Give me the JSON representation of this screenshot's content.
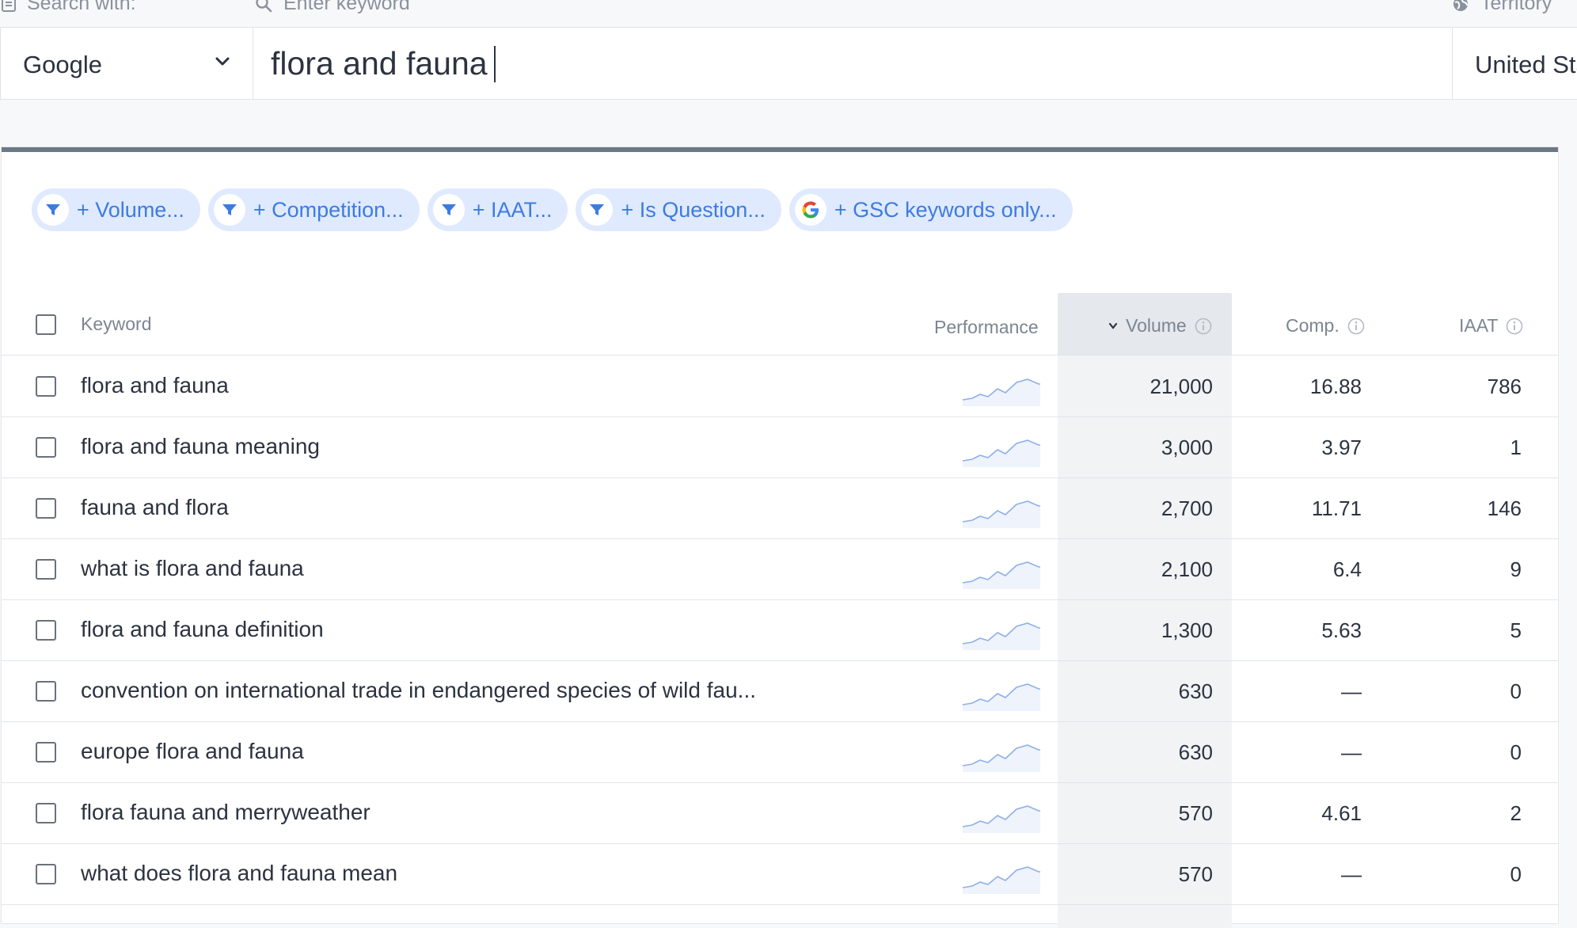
{
  "top": {
    "search_with_label": "Search with:",
    "keyword_placeholder_label": "Enter keyword",
    "territory_label": "Territory"
  },
  "search": {
    "engine": "Google",
    "query": "flora and fauna",
    "territory": "United States"
  },
  "filters": [
    {
      "label": "+ Volume...",
      "icon": "funnel-icon"
    },
    {
      "label": "+ Competition...",
      "icon": "funnel-icon"
    },
    {
      "label": "+ IAAT...",
      "icon": "funnel-icon"
    },
    {
      "label": "+ Is Question...",
      "icon": "funnel-icon"
    },
    {
      "label": "+ GSC keywords only...",
      "icon": "google-g-icon"
    }
  ],
  "table": {
    "headers": {
      "keyword": "Keyword",
      "performance": "Performance",
      "volume": "Volume",
      "comp": "Comp.",
      "iaat": "IAAT"
    },
    "sorted_by": "volume",
    "rows": [
      {
        "keyword": "flora and fauna",
        "volume": "21,000",
        "comp": "16.88",
        "iaat": "786"
      },
      {
        "keyword": "flora and fauna meaning",
        "volume": "3,000",
        "comp": "3.97",
        "iaat": "1"
      },
      {
        "keyword": "fauna and flora",
        "volume": "2,700",
        "comp": "11.71",
        "iaat": "146"
      },
      {
        "keyword": "what is flora and fauna",
        "volume": "2,100",
        "comp": "6.4",
        "iaat": "9"
      },
      {
        "keyword": "flora and fauna definition",
        "volume": "1,300",
        "comp": "5.63",
        "iaat": "5"
      },
      {
        "keyword": "convention on international trade in endangered species of wild fau...",
        "volume": "630",
        "comp": "—",
        "iaat": "0"
      },
      {
        "keyword": "europe flora and fauna",
        "volume": "630",
        "comp": "—",
        "iaat": "0"
      },
      {
        "keyword": "flora fauna and merryweather",
        "volume": "570",
        "comp": "4.61",
        "iaat": "2"
      },
      {
        "keyword": "what does flora and fauna mean",
        "volume": "570",
        "comp": "—",
        "iaat": "0"
      }
    ]
  },
  "colors": {
    "accent": "#3d7be0",
    "chip_bg": "#dfeaff",
    "panel_top_border": "#6b7885",
    "sparkline": "#8fb0e6"
  }
}
